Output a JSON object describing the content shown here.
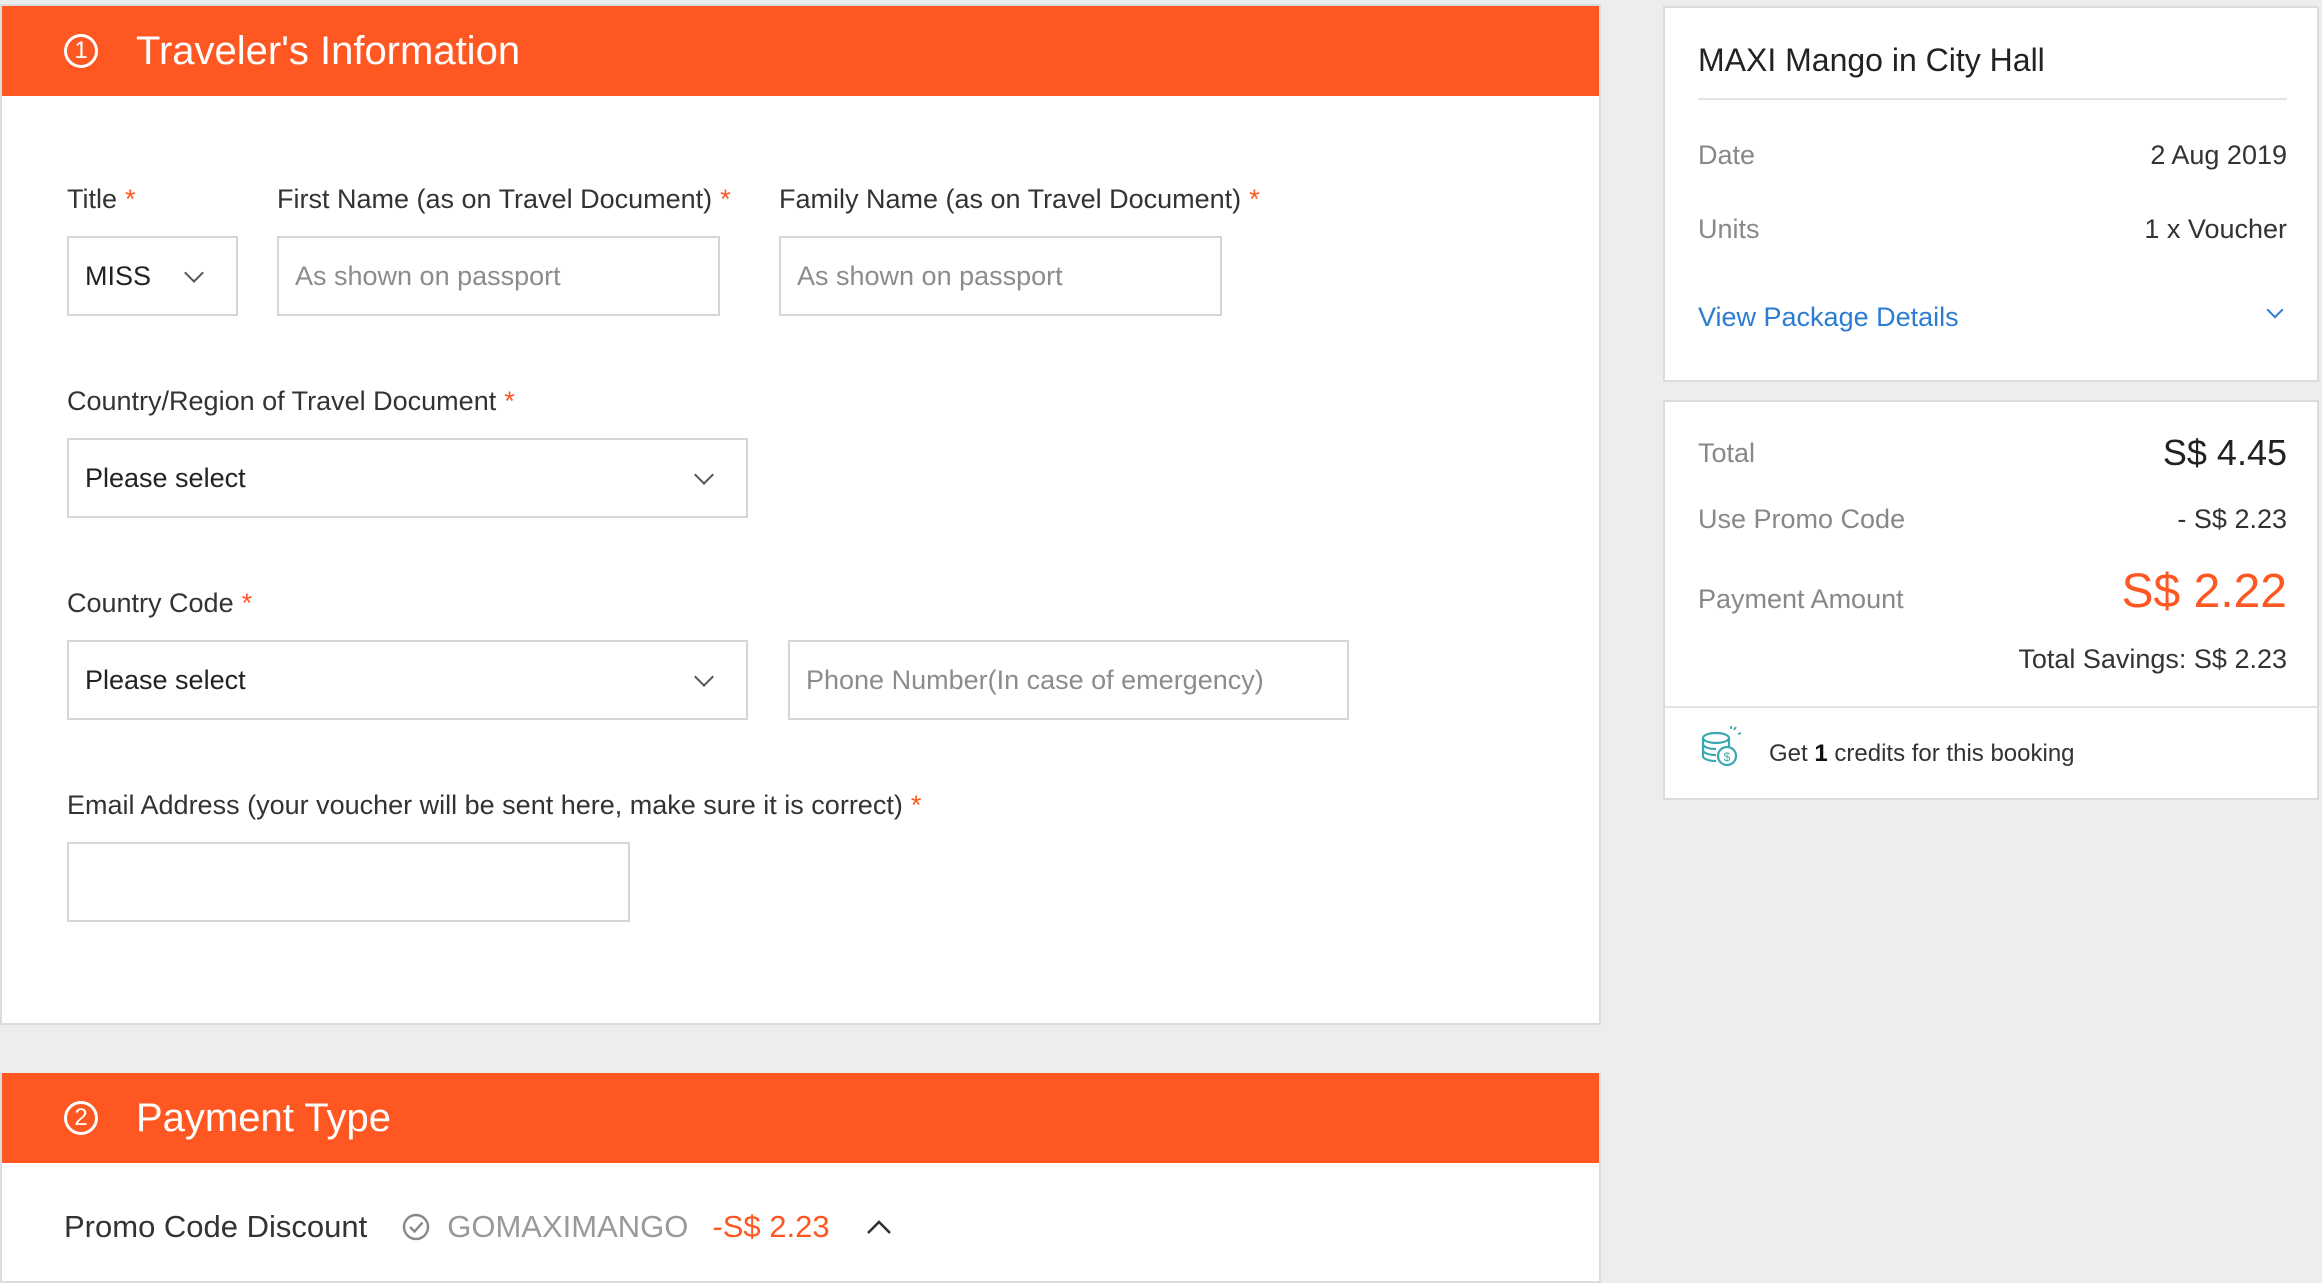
{
  "travelers_info": {
    "step_number": "1",
    "title": "Traveler's Information",
    "fields": {
      "title_label": "Title",
      "title_value": "MISS",
      "first_name_label": "First Name (as on Travel Document)",
      "first_name_placeholder": "As shown on passport",
      "family_name_label": "Family Name (as on Travel Document)",
      "family_name_placeholder": "As shown on passport",
      "country_region_label": "Country/Region of Travel Document",
      "country_region_value": "Please select",
      "country_code_label": "Country Code",
      "country_code_value": "Please select",
      "phone_placeholder": "Phone Number(In case of emergency)",
      "email_label": "Email Address (your voucher will be sent here, make sure it is correct)",
      "email_value": ""
    },
    "required_mark": "*"
  },
  "payment_type": {
    "step_number": "2",
    "title": "Payment Type",
    "promo_label": "Promo Code Discount",
    "promo_code": "GOMAXIMANGO",
    "promo_amount": "-S$ 2.23"
  },
  "summary": {
    "product_title": "MAXI Mango in City Hall",
    "date_label": "Date",
    "date_value": "2 Aug 2019",
    "units_label": "Units",
    "units_value": "1 x Voucher",
    "view_details": "View Package Details"
  },
  "pricing": {
    "total_label": "Total",
    "total_value": "S$ 4.45",
    "promo_label": "Use Promo Code",
    "promo_value": "- S$ 2.23",
    "payment_label": "Payment Amount",
    "payment_value": "S$ 2.22",
    "savings": "Total Savings: S$ 2.23",
    "credits_prefix": "Get",
    "credits_count": "1",
    "credits_suffix": "credits for this booking"
  },
  "colors": {
    "accent": "#ff5722",
    "link": "#2a7dd2",
    "credit_icon": "#3aa8b0"
  }
}
